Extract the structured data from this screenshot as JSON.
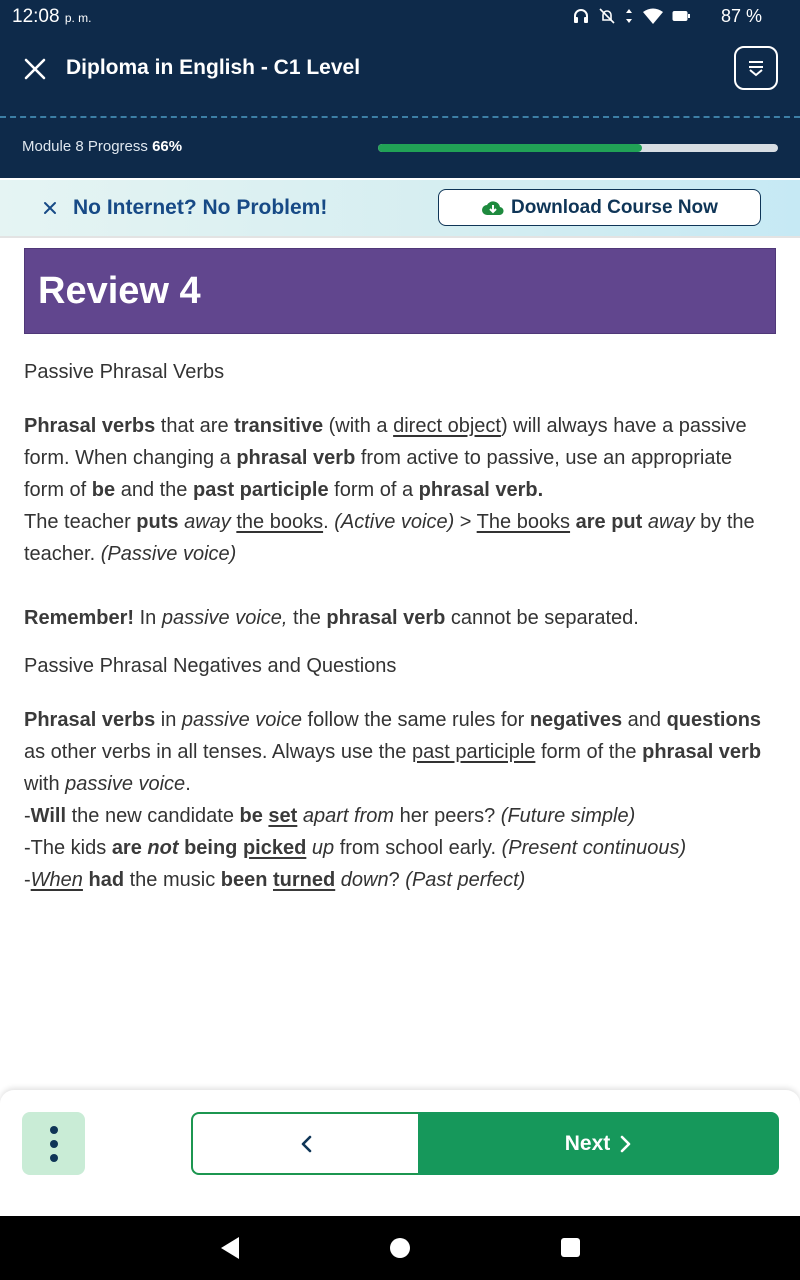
{
  "status_bar": {
    "time": "12:08",
    "time_suffix": "p. m.",
    "battery": "87 %"
  },
  "header": {
    "title": "Diploma in English - C1 Level"
  },
  "progress": {
    "label": "Module 8 Progress",
    "value_text": "66%",
    "fraction": 0.66
  },
  "banner": {
    "text": "No Internet? No Problem!",
    "download_label": "Download Course Now"
  },
  "lesson": {
    "title": "Review 4",
    "section1_title": "Passive Phrasal Verbs",
    "p1": {
      "s1": "Phrasal verbs",
      "s2": " that are ",
      "s3": "transitive",
      "s4": " (with a ",
      "s5": "direct object",
      "s6": ") will always have a passive form. When changing a ",
      "s7": "phrasal verb",
      "s8": " from active to passive, use an appropriate form of ",
      "s9": "be",
      "s10": " and the ",
      "s11": "past participle",
      "s12": " form of a ",
      "s13": "phrasal verb."
    },
    "example1": {
      "s1": "The teacher ",
      "s2": "puts",
      "s3": " ",
      "s4": "away",
      "s5": " ",
      "s6": "the books",
      "s7": ". ",
      "s8": "(Active voice)",
      "s9": " > ",
      "s10": "The books",
      "s11": " ",
      "s12": "are put",
      "s13": " ",
      "s14": "away",
      "s15": " by the teacher. ",
      "s16": "(Passive voice)"
    },
    "remember": {
      "s1": "Remember!",
      "s2": " In ",
      "s3": "passive voice,",
      "s4": " the ",
      "s5": "phrasal verb",
      "s6": " cannot be separated."
    },
    "section2_title": "Passive Phrasal Negatives and Questions",
    "p2": {
      "s1": "Phrasal verbs",
      "s2": " in ",
      "s3": "passive voice",
      "s4": " follow the same rules for ",
      "s5": "negatives",
      "s6": " and ",
      "s7": "questions",
      "s8": " as other verbs in all tenses. Always use the ",
      "s9": "past participle",
      "s10": " form of the ",
      "s11": "phrasal verb",
      "s12": " with ",
      "s13": "passive voice",
      "s14": "."
    },
    "ex_a": {
      "s1": "-",
      "s2": "Will",
      "s3": " the new candidate ",
      "s4": "be",
      "s5": " ",
      "s6": "set",
      "s7": " ",
      "s8": "apart from",
      "s9": " her peers? ",
      "s10": "(Future simple)"
    },
    "ex_b": {
      "s1": "-The kids ",
      "s2": "are",
      "s3": " ",
      "s4": "not",
      "s5": " ",
      "s6": "being",
      "s7": " ",
      "s8": "picked",
      "s9": " ",
      "s10": "up",
      "s11": " from school early. ",
      "s12": "(Present continuous)"
    },
    "ex_c": {
      "s1": "-",
      "s2": "When",
      "s3": " ",
      "s4": "had",
      "s5": " the music ",
      "s6": "been",
      "s7": " ",
      "s8": "turned",
      "s9": " ",
      "s10": "down",
      "s11": "? ",
      "s12": "(Past perfect)"
    }
  },
  "bottom_nav": {
    "next_label": "Next"
  },
  "icons": {
    "close": "close-icon",
    "menu": "chevron-menu-icon",
    "download": "cloud-download-icon",
    "prev": "chevron-left-icon",
    "next": "chevron-right-icon",
    "more": "more-vertical-icon"
  },
  "colors": {
    "header_bg": "#0e2a4a",
    "progress": "#21a256",
    "review_bg": "#61468e",
    "next_bg": "#16985b",
    "banner_text": "#174a86"
  }
}
